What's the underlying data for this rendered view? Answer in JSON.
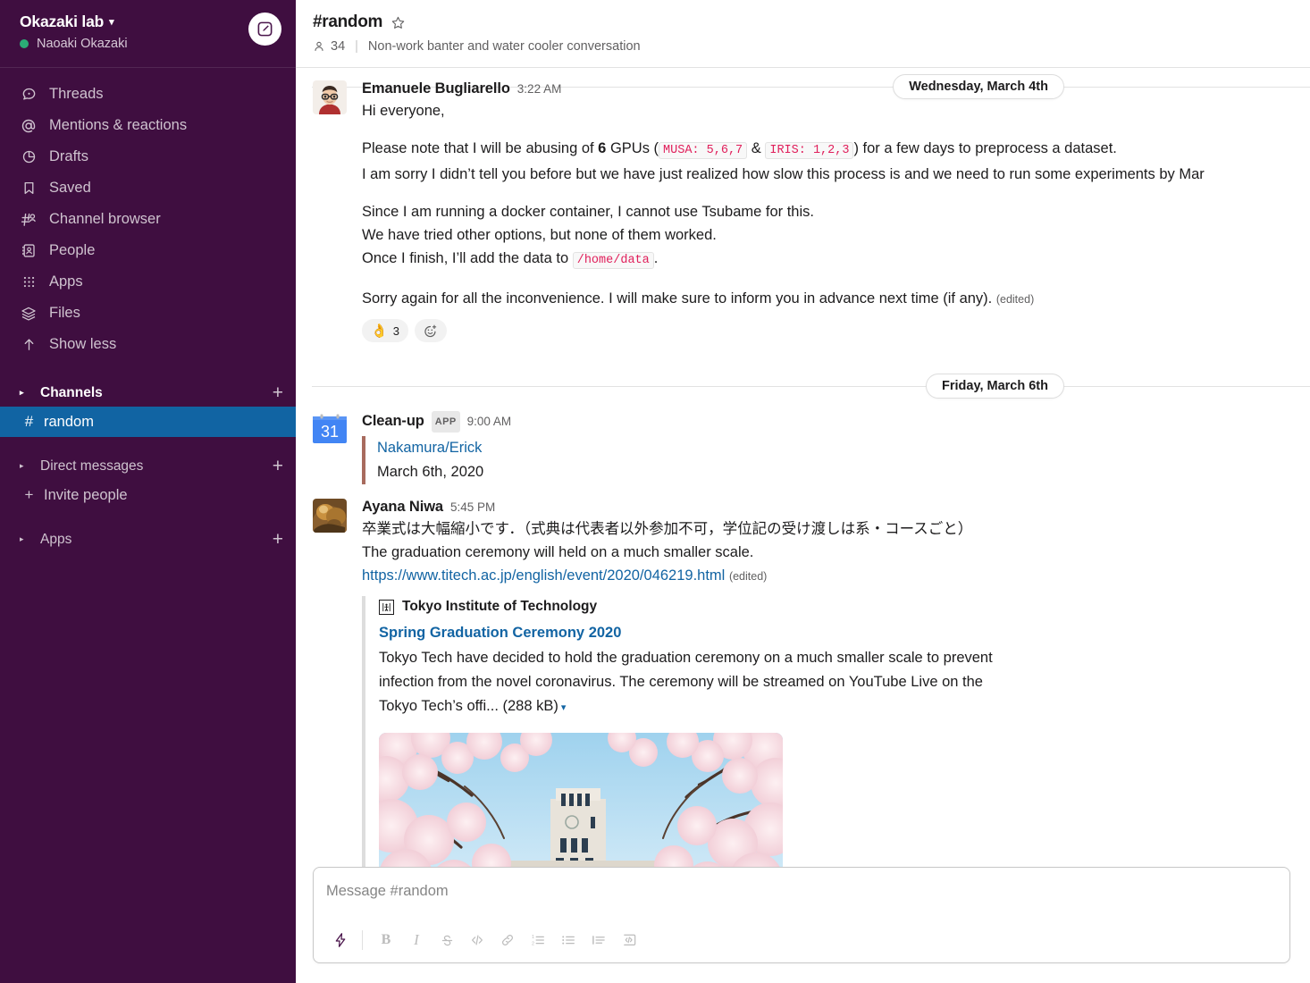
{
  "workspace": {
    "name": "Okazaki lab",
    "user": "Naoaki Okazaki",
    "chevron": "▾"
  },
  "sidebar": {
    "nav_items": [
      {
        "label": "Threads",
        "icon": "threads-icon"
      },
      {
        "label": "Mentions & reactions",
        "icon": "at-icon"
      },
      {
        "label": "Drafts",
        "icon": "drafts-icon"
      },
      {
        "label": "Saved",
        "icon": "bookmark-icon"
      },
      {
        "label": "Channel browser",
        "icon": "channel-browser-icon"
      },
      {
        "label": "People",
        "icon": "people-icon"
      },
      {
        "label": "Apps",
        "icon": "apps-grid-icon"
      },
      {
        "label": "Files",
        "icon": "files-layers-icon"
      },
      {
        "label": "Show less",
        "icon": "arrow-up-icon"
      }
    ],
    "sections": {
      "channels_label": "Channels",
      "direct_messages_label": "Direct messages",
      "apps_label": "Apps",
      "invite_label": "Invite people",
      "plus": "+",
      "caret": "▸"
    },
    "channels": [
      {
        "name": "random",
        "hash": "#",
        "active": true
      }
    ]
  },
  "channel_header": {
    "title": "#random",
    "member_count": "34",
    "topic": "Non-work banter and water cooler conversation"
  },
  "dividers": {
    "first": "Wednesday, March 4th",
    "second": "Friday, March 6th"
  },
  "messages": [
    {
      "author": "Emanuele Bugliarello",
      "time": "3:22 AM",
      "greeting": "Hi everyone,",
      "p2_pre": "Please note that I will be abusing of ",
      "p2_bold": "6",
      "p2_mid": " GPUs (",
      "p2_code1": "MUSA: 5,6,7",
      "p2_amp": " & ",
      "p2_code2": "IRIS: 1,2,3",
      "p2_post": ") for a few days to preprocess a dataset.",
      "p2_line2": "I am sorry I didn’t tell you before but we have just realized how slow this process is and we need to run some experiments by Mar",
      "p3_line1": "Since I am running a docker container, I cannot use Tsubame for this.",
      "p3_line2": "We have tried other options, but none of them worked.",
      "p3_line3_pre": "Once I finish, I’ll add the data to ",
      "p3_code": "/home/data",
      "p3_line3_post": ".",
      "p4": "Sorry again for all the inconvenience. I will make sure to inform you in advance next time (if any).",
      "edited": "(edited)",
      "reaction_emoji": "👌",
      "reaction_count": "3"
    },
    {
      "author": "Clean-up",
      "app_badge": "APP",
      "time": "9:00 AM",
      "calendar_day": "31",
      "attach_link": "Nakamura/Erick",
      "attach_date": "March 6th, 2020"
    },
    {
      "author": "Ayana Niwa",
      "time": "5:45 PM",
      "line_ja": "卒業式は大幅縮小です．（式典は代表者以外参加不可，学位記の受け渡しは系・コースごと）",
      "line_en": "The graduation ceremony will held on a much smaller scale.",
      "url": "https://www.titech.ac.jp/english/event/2020/046219.html",
      "edited": "(edited)",
      "preview": {
        "service": "Tokyo Institute of Technology",
        "title": "Spring Graduation Ceremony 2020",
        "description": "Tokyo Tech have decided to hold the graduation ceremony on a much smaller scale to prevent infection from the novel coronavirus. The ceremony will be streamed on YouTube Live on the Tokyo Tech’s offi...",
        "size": "(288 kB)",
        "caret": "▾"
      }
    }
  ],
  "composer": {
    "placeholder": "Message #random",
    "toolbar": [
      {
        "name": "shortcuts-lightning-icon",
        "label": ""
      },
      {
        "name": "bold-icon",
        "label": "B"
      },
      {
        "name": "italic-icon",
        "label": "I"
      },
      {
        "name": "strikethrough-icon",
        "label": ""
      },
      {
        "name": "code-icon",
        "label": ""
      },
      {
        "name": "link-icon",
        "label": ""
      },
      {
        "name": "ordered-list-icon",
        "label": ""
      },
      {
        "name": "bulleted-list-icon",
        "label": ""
      },
      {
        "name": "blockquote-icon",
        "label": ""
      },
      {
        "name": "code-block-icon",
        "label": ""
      }
    ]
  },
  "colors": {
    "sidebar_bg": "#3F0E40",
    "active_channel": "#1164A3",
    "link": "#1264A3",
    "code_text": "#E01E5A",
    "presence_green": "#2BAC76"
  }
}
